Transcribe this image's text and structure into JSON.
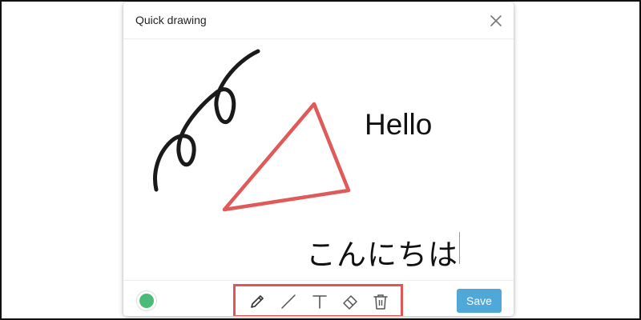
{
  "dialog": {
    "title": "Quick drawing",
    "close_icon": "close-icon"
  },
  "canvas": {
    "texts": {
      "hello": "Hello",
      "japanese": "こんにちは"
    },
    "strokes": {
      "scribble_color": "#1a1a1a",
      "triangle_color": "#e05a5a"
    }
  },
  "footer": {
    "current_color": "#4cbb7a",
    "tools": [
      {
        "name": "pencil-icon"
      },
      {
        "name": "line-icon"
      },
      {
        "name": "text-icon"
      },
      {
        "name": "eraser-icon"
      },
      {
        "name": "trash-icon"
      }
    ],
    "tool_group_highlight": "#e05555",
    "save_label": "Save",
    "save_color": "#4fa8d8"
  }
}
